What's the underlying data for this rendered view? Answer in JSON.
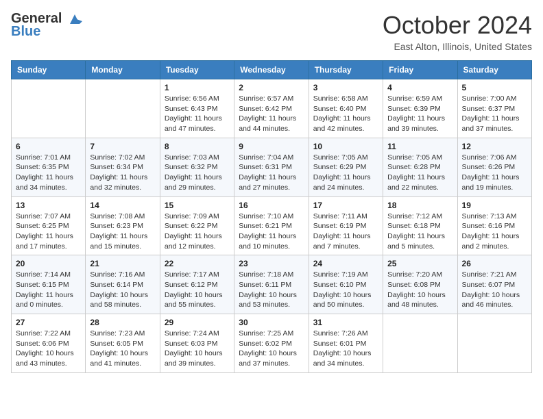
{
  "header": {
    "logo_line1": "General",
    "logo_line2": "Blue",
    "month": "October 2024",
    "location": "East Alton, Illinois, United States"
  },
  "days_of_week": [
    "Sunday",
    "Monday",
    "Tuesday",
    "Wednesday",
    "Thursday",
    "Friday",
    "Saturday"
  ],
  "weeks": [
    [
      {
        "day": "",
        "detail": ""
      },
      {
        "day": "",
        "detail": ""
      },
      {
        "day": "1",
        "detail": "Sunrise: 6:56 AM\nSunset: 6:43 PM\nDaylight: 11 hours and 47 minutes."
      },
      {
        "day": "2",
        "detail": "Sunrise: 6:57 AM\nSunset: 6:42 PM\nDaylight: 11 hours and 44 minutes."
      },
      {
        "day": "3",
        "detail": "Sunrise: 6:58 AM\nSunset: 6:40 PM\nDaylight: 11 hours and 42 minutes."
      },
      {
        "day": "4",
        "detail": "Sunrise: 6:59 AM\nSunset: 6:39 PM\nDaylight: 11 hours and 39 minutes."
      },
      {
        "day": "5",
        "detail": "Sunrise: 7:00 AM\nSunset: 6:37 PM\nDaylight: 11 hours and 37 minutes."
      }
    ],
    [
      {
        "day": "6",
        "detail": "Sunrise: 7:01 AM\nSunset: 6:35 PM\nDaylight: 11 hours and 34 minutes."
      },
      {
        "day": "7",
        "detail": "Sunrise: 7:02 AM\nSunset: 6:34 PM\nDaylight: 11 hours and 32 minutes."
      },
      {
        "day": "8",
        "detail": "Sunrise: 7:03 AM\nSunset: 6:32 PM\nDaylight: 11 hours and 29 minutes."
      },
      {
        "day": "9",
        "detail": "Sunrise: 7:04 AM\nSunset: 6:31 PM\nDaylight: 11 hours and 27 minutes."
      },
      {
        "day": "10",
        "detail": "Sunrise: 7:05 AM\nSunset: 6:29 PM\nDaylight: 11 hours and 24 minutes."
      },
      {
        "day": "11",
        "detail": "Sunrise: 7:05 AM\nSunset: 6:28 PM\nDaylight: 11 hours and 22 minutes."
      },
      {
        "day": "12",
        "detail": "Sunrise: 7:06 AM\nSunset: 6:26 PM\nDaylight: 11 hours and 19 minutes."
      }
    ],
    [
      {
        "day": "13",
        "detail": "Sunrise: 7:07 AM\nSunset: 6:25 PM\nDaylight: 11 hours and 17 minutes."
      },
      {
        "day": "14",
        "detail": "Sunrise: 7:08 AM\nSunset: 6:23 PM\nDaylight: 11 hours and 15 minutes."
      },
      {
        "day": "15",
        "detail": "Sunrise: 7:09 AM\nSunset: 6:22 PM\nDaylight: 11 hours and 12 minutes."
      },
      {
        "day": "16",
        "detail": "Sunrise: 7:10 AM\nSunset: 6:21 PM\nDaylight: 11 hours and 10 minutes."
      },
      {
        "day": "17",
        "detail": "Sunrise: 7:11 AM\nSunset: 6:19 PM\nDaylight: 11 hours and 7 minutes."
      },
      {
        "day": "18",
        "detail": "Sunrise: 7:12 AM\nSunset: 6:18 PM\nDaylight: 11 hours and 5 minutes."
      },
      {
        "day": "19",
        "detail": "Sunrise: 7:13 AM\nSunset: 6:16 PM\nDaylight: 11 hours and 2 minutes."
      }
    ],
    [
      {
        "day": "20",
        "detail": "Sunrise: 7:14 AM\nSunset: 6:15 PM\nDaylight: 11 hours and 0 minutes."
      },
      {
        "day": "21",
        "detail": "Sunrise: 7:16 AM\nSunset: 6:14 PM\nDaylight: 10 hours and 58 minutes."
      },
      {
        "day": "22",
        "detail": "Sunrise: 7:17 AM\nSunset: 6:12 PM\nDaylight: 10 hours and 55 minutes."
      },
      {
        "day": "23",
        "detail": "Sunrise: 7:18 AM\nSunset: 6:11 PM\nDaylight: 10 hours and 53 minutes."
      },
      {
        "day": "24",
        "detail": "Sunrise: 7:19 AM\nSunset: 6:10 PM\nDaylight: 10 hours and 50 minutes."
      },
      {
        "day": "25",
        "detail": "Sunrise: 7:20 AM\nSunset: 6:08 PM\nDaylight: 10 hours and 48 minutes."
      },
      {
        "day": "26",
        "detail": "Sunrise: 7:21 AM\nSunset: 6:07 PM\nDaylight: 10 hours and 46 minutes."
      }
    ],
    [
      {
        "day": "27",
        "detail": "Sunrise: 7:22 AM\nSunset: 6:06 PM\nDaylight: 10 hours and 43 minutes."
      },
      {
        "day": "28",
        "detail": "Sunrise: 7:23 AM\nSunset: 6:05 PM\nDaylight: 10 hours and 41 minutes."
      },
      {
        "day": "29",
        "detail": "Sunrise: 7:24 AM\nSunset: 6:03 PM\nDaylight: 10 hours and 39 minutes."
      },
      {
        "day": "30",
        "detail": "Sunrise: 7:25 AM\nSunset: 6:02 PM\nDaylight: 10 hours and 37 minutes."
      },
      {
        "day": "31",
        "detail": "Sunrise: 7:26 AM\nSunset: 6:01 PM\nDaylight: 10 hours and 34 minutes."
      },
      {
        "day": "",
        "detail": ""
      },
      {
        "day": "",
        "detail": ""
      }
    ]
  ]
}
